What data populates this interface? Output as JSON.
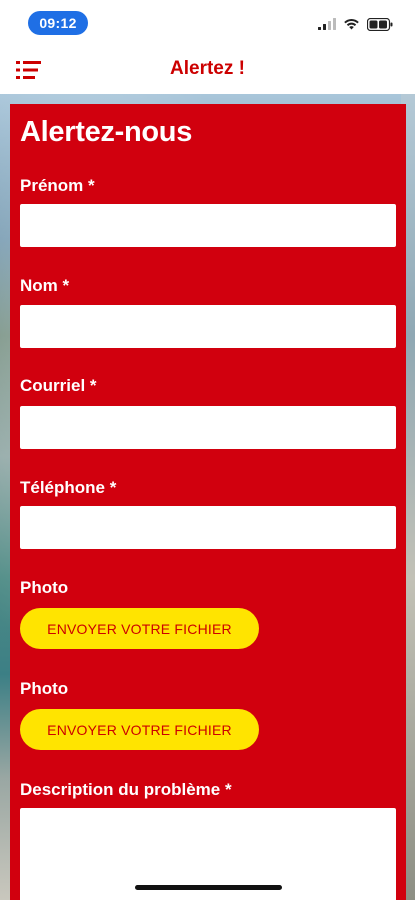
{
  "status_bar": {
    "time": "09:12",
    "icons": [
      "cellular-signal-icon",
      "wifi-icon",
      "battery-icon"
    ]
  },
  "header": {
    "title": "Alertez !",
    "menu_icon": "menu-list-icon"
  },
  "form": {
    "heading": "Alertez-nous",
    "fields": {
      "first_name": {
        "label": "Prénom *",
        "value": ""
      },
      "last_name": {
        "label": "Nom *",
        "value": ""
      },
      "email": {
        "label": "Courriel *",
        "value": ""
      },
      "phone": {
        "label": "Téléphone *",
        "value": ""
      },
      "photo_1": {
        "label": "Photo",
        "button": "ENVOYER VOTRE FICHIER"
      },
      "photo_2": {
        "label": "Photo",
        "button": "ENVOYER VOTRE FICHIER"
      },
      "description": {
        "label": "Description du problème *",
        "value": ""
      }
    }
  },
  "colors": {
    "brand_red": "#d1000e",
    "title_red": "#cc0000",
    "button_yellow": "#ffe400",
    "time_pill_blue": "#1f6fe5"
  }
}
